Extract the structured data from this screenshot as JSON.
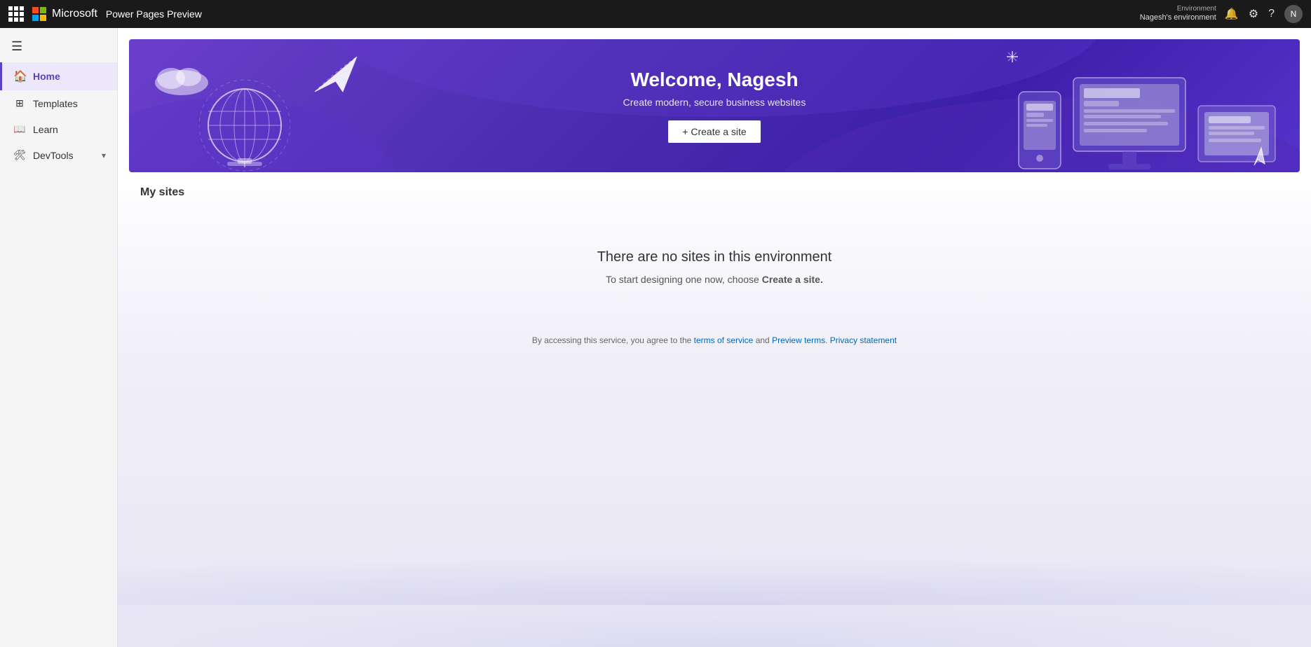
{
  "topbar": {
    "app_title": "Power Pages Preview",
    "microsoft_label": "Microsoft",
    "environment_label": "Environment",
    "environment_name": "Nagesh's environment",
    "notification_icon": "🔔",
    "settings_icon": "⚙",
    "help_icon": "?"
  },
  "sidebar": {
    "menu_icon": "☰",
    "items": [
      {
        "id": "home",
        "label": "Home",
        "icon": "🏠",
        "active": true
      },
      {
        "id": "templates",
        "label": "Templates",
        "icon": "▦",
        "active": false
      },
      {
        "id": "learn",
        "label": "Learn",
        "icon": "📖",
        "active": false
      },
      {
        "id": "devtools",
        "label": "DevTools",
        "icon": "🛠",
        "active": false,
        "has_chevron": true
      }
    ]
  },
  "hero": {
    "title": "Welcome, Nagesh",
    "subtitle": "Create modern, secure business websites",
    "cta_label": "+ Create a site"
  },
  "main": {
    "my_sites_label": "My sites",
    "no_sites_title": "There are no sites in this environment",
    "no_sites_sub_before": "To start designing one now, choose ",
    "no_sites_sub_link": "Create a site.",
    "no_sites_sub_after": ""
  },
  "footer": {
    "text_before": "By accessing this service, you agree to the ",
    "tos_label": "terms of service",
    "tos_url": "#",
    "text_mid": " and ",
    "preview_label": "Preview terms",
    "preview_url": "#",
    "text_end": ". ",
    "privacy_label": "Privacy statement",
    "privacy_url": "#"
  }
}
